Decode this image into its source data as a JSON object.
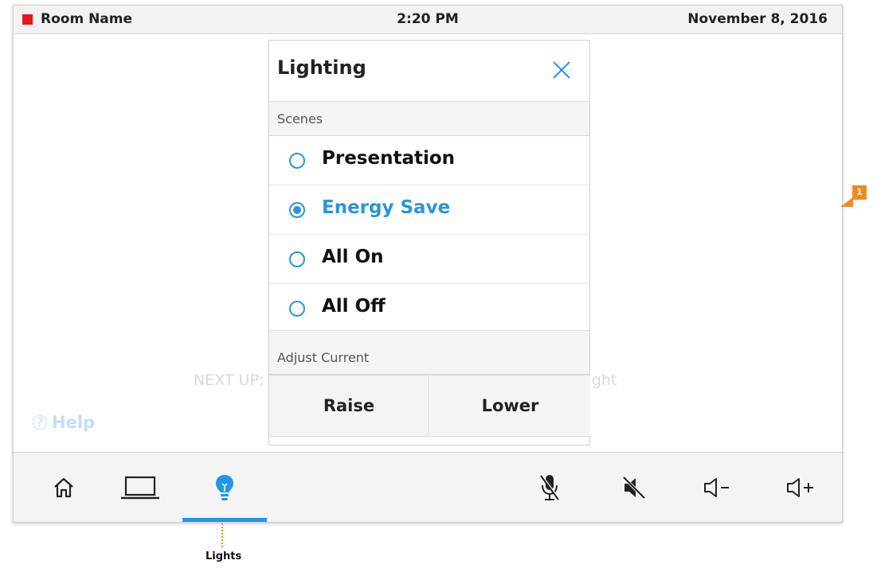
{
  "status_bar": {
    "room_name": "Room Name",
    "time": "2:20 PM",
    "date": "November 8, 2016"
  },
  "background": {
    "next_up": "NEXT UP:",
    "cartwright": "Cartwright",
    "help": "Help"
  },
  "lighting_panel": {
    "title": "Lighting",
    "scenes_header": "Scenes",
    "scenes": [
      {
        "label": "Presentation",
        "selected": false
      },
      {
        "label": "Energy Save",
        "selected": true
      },
      {
        "label": "All On",
        "selected": false
      },
      {
        "label": "All Off",
        "selected": false
      }
    ],
    "adjust_header": "Adjust Current",
    "raise_label": "Raise",
    "lower_label": "Lower"
  },
  "toolbar": {
    "items": [
      {
        "icon": "home-icon"
      },
      {
        "icon": "laptop-icon"
      },
      {
        "icon": "lightbulb-icon",
        "active": true
      },
      {
        "icon": "mic-mute-icon"
      },
      {
        "icon": "speaker-mute-icon"
      },
      {
        "icon": "volume-down-icon"
      },
      {
        "icon": "volume-up-icon"
      }
    ]
  },
  "annotations": {
    "callout_label": "Lights",
    "badge_number": "1"
  },
  "colors": {
    "accent": "#2a94de",
    "room_indicator": "#e8151b",
    "annotation": "#f08a24"
  }
}
